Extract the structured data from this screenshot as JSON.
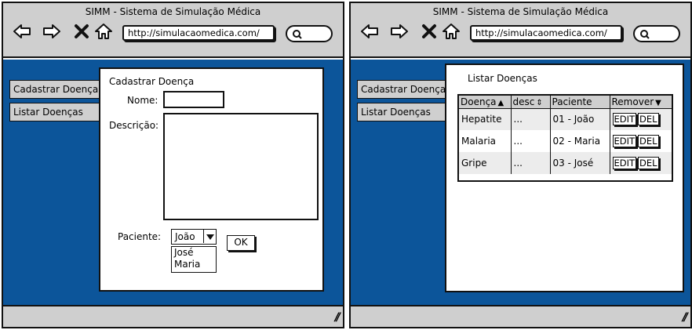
{
  "browser": {
    "title": "SIMM - Sistema de Simulação Médica",
    "url": "http://simulacaomedica.com/",
    "icons": [
      "back-arrow-icon",
      "forward-arrow-icon",
      "close-x-icon",
      "home-icon",
      "search-icon",
      "resize-grip-icon"
    ]
  },
  "colors": {
    "content_bg": "#0c559a",
    "chrome": "#cfcfcf"
  },
  "sidebar": {
    "items": [
      {
        "label": "Cadastrar Doença"
      },
      {
        "label": "Listar Doenças"
      }
    ]
  },
  "form": {
    "title": "Cadastrar Doença",
    "name_label": "Nome:",
    "description_label": "Descrição:",
    "patient_label": "Paciente:",
    "patient_selected": "João",
    "patient_options": [
      "José",
      "Maria"
    ],
    "ok_label": "OK"
  },
  "list": {
    "title": "Listar Doenças",
    "columns": [
      "Doença",
      "desc",
      "Paciente",
      "Remover"
    ],
    "rows": [
      {
        "disease": "Hepatite",
        "desc": "...",
        "patient": "01 - João"
      },
      {
        "disease": "Malaria",
        "desc": "...",
        "patient": "02 - Maria"
      },
      {
        "disease": "Gripe",
        "desc": "...",
        "patient": "03 - José"
      }
    ],
    "edit_label": "EDIT",
    "delete_label": "DEL"
  }
}
